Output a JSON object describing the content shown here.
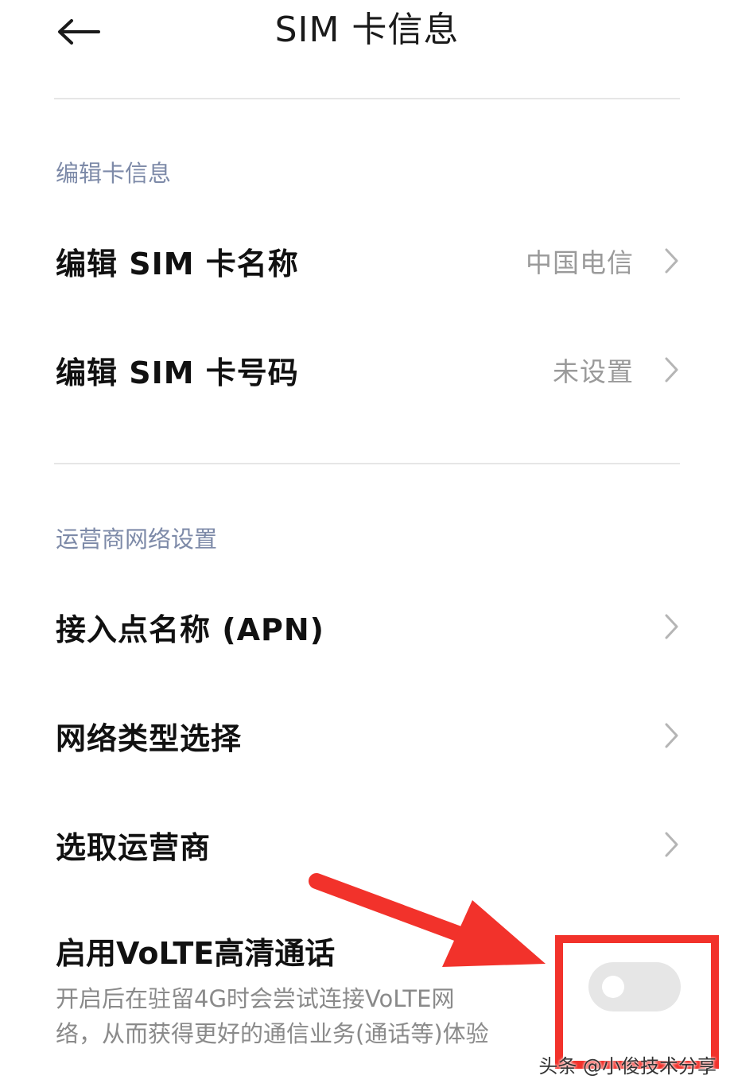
{
  "header": {
    "title": "SIM 卡信息",
    "back_icon": "arrow-left-icon"
  },
  "sections": [
    {
      "title": "编辑卡信息",
      "items": [
        {
          "label": "编辑 SIM 卡名称",
          "value": "中国电信"
        },
        {
          "label": "编辑 SIM 卡号码",
          "value": "未设置"
        }
      ]
    },
    {
      "title": "运营商网络设置",
      "items": [
        {
          "label": "接入点名称 (APN)",
          "value": ""
        },
        {
          "label": "网络类型选择",
          "value": ""
        },
        {
          "label": "选取运营商",
          "value": ""
        }
      ]
    }
  ],
  "volte": {
    "title": "启用VoLTE高清通话",
    "description_line1": "开启后在驻留4G时会尝试连接VoLTE网",
    "description_line2": "络，从而获得更好的通信业务(通话等)体验",
    "enabled": false
  },
  "annotation": {
    "color": "#f2322b"
  },
  "watermark": "头条 @小俊技术分享"
}
